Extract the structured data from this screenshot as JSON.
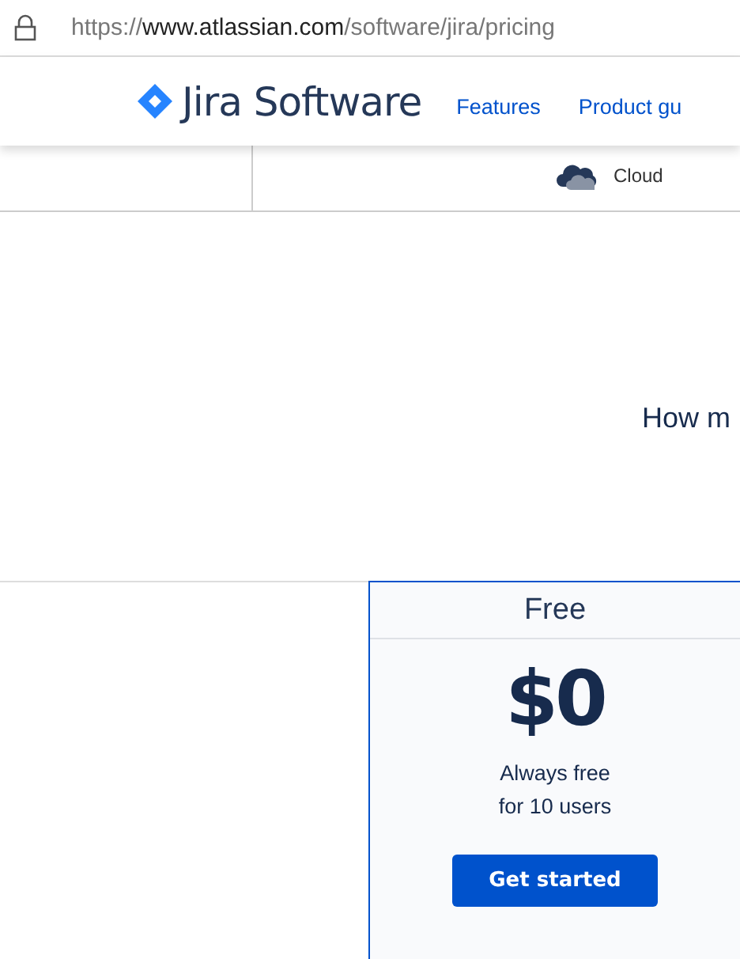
{
  "address_bar": {
    "scheme": "https://",
    "host": "www.atlassian.com",
    "path": "/software/jira/pricing"
  },
  "header": {
    "logo_text": "Jira Software",
    "nav": [
      {
        "label": "Features"
      },
      {
        "label": "Product gu"
      }
    ]
  },
  "deployment": {
    "label": "Cloud"
  },
  "question": "How m",
  "plans": [
    {
      "name": "Free",
      "price": "$0",
      "description_lines": [
        "Always free",
        "for 10 users"
      ],
      "button": "Get started",
      "selected": true
    }
  ]
}
